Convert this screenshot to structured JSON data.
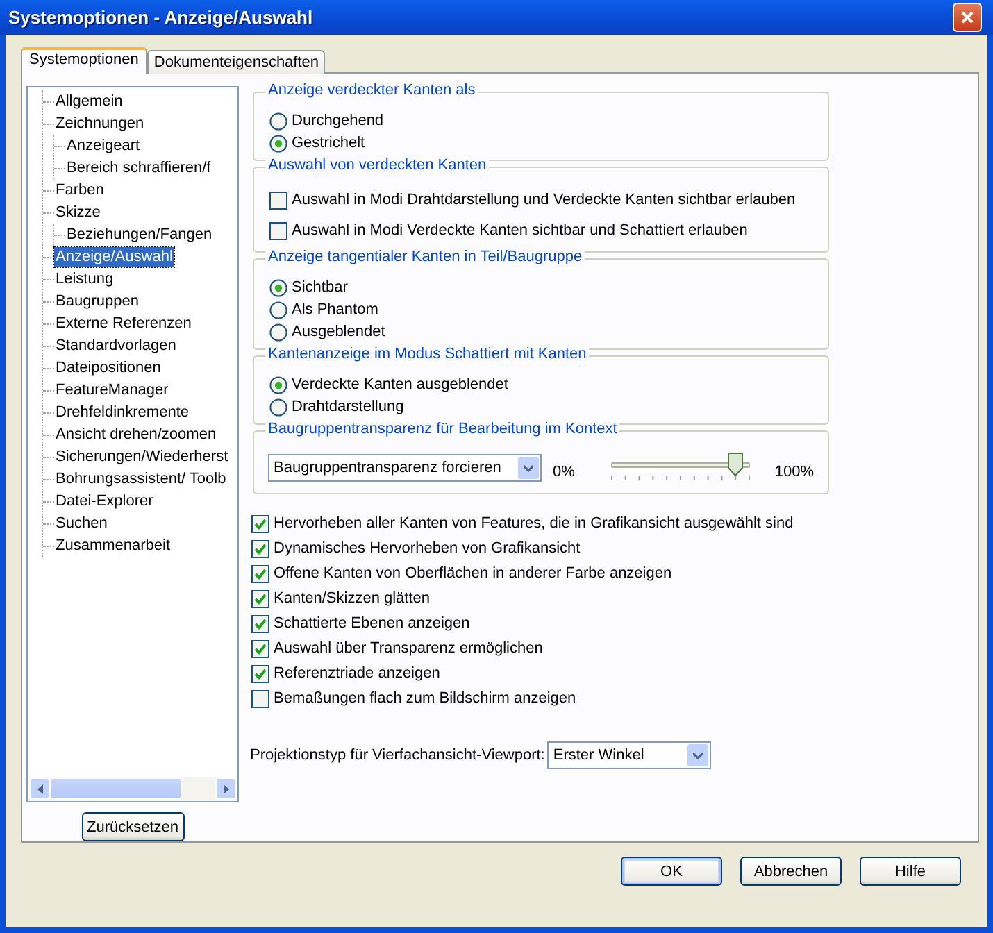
{
  "window": {
    "title": "Systemoptionen - Anzeige/Auswahl"
  },
  "tabs": [
    {
      "label": "Systemoptionen",
      "selected": true
    },
    {
      "label": "Dokumenteigenschaften",
      "selected": false
    }
  ],
  "tree": {
    "items": [
      {
        "label": "Allgemein",
        "selected": false
      },
      {
        "label": "Zeichnungen",
        "selected": false,
        "children": [
          {
            "label": "Anzeigeart",
            "selected": false
          },
          {
            "label": "Bereich schraffieren/f",
            "selected": false
          }
        ]
      },
      {
        "label": "Farben",
        "selected": false
      },
      {
        "label": "Skizze",
        "selected": false,
        "children": [
          {
            "label": "Beziehungen/Fangen",
            "selected": false
          }
        ]
      },
      {
        "label": "Anzeige/Auswahl",
        "selected": true
      },
      {
        "label": "Leistung",
        "selected": false
      },
      {
        "label": "Baugruppen",
        "selected": false
      },
      {
        "label": "Externe Referenzen",
        "selected": false
      },
      {
        "label": "Standardvorlagen",
        "selected": false
      },
      {
        "label": "Dateipositionen",
        "selected": false
      },
      {
        "label": "FeatureManager",
        "selected": false
      },
      {
        "label": "Drehfeldinkremente",
        "selected": false
      },
      {
        "label": "Ansicht drehen/zoomen",
        "selected": false
      },
      {
        "label": "Sicherungen/Wiederherst",
        "selected": false
      },
      {
        "label": "Bohrungsassistent/ Toolb",
        "selected": false
      },
      {
        "label": "Datei-Explorer",
        "selected": false
      },
      {
        "label": "Suchen",
        "selected": false
      },
      {
        "label": "Zusammenarbeit",
        "selected": false
      }
    ]
  },
  "reset_button": "Zurücksetzen",
  "groups": [
    {
      "title": "Anzeige verdeckter Kanten als",
      "options": [
        {
          "kind": "radio",
          "label": "Durchgehend",
          "selected": false
        },
        {
          "kind": "radio",
          "label": "Gestrichelt",
          "selected": true
        }
      ]
    },
    {
      "title": "Auswahl von verdeckten Kanten",
      "options": [
        {
          "kind": "checkbox",
          "label": "Auswahl in Modi Drahtdarstellung und Verdeckte Kanten sichtbar erlauben",
          "checked": false
        },
        {
          "kind": "checkbox",
          "label": "Auswahl in Modi Verdeckte Kanten sichtbar und Schattiert erlauben",
          "checked": false
        }
      ]
    },
    {
      "title": "Anzeige tangentialer Kanten in Teil/Baugruppe",
      "options": [
        {
          "kind": "radio",
          "label": "Sichtbar",
          "selected": true
        },
        {
          "kind": "radio",
          "label": "Als Phantom",
          "selected": false
        },
        {
          "kind": "radio",
          "label": "Ausgeblendet",
          "selected": false
        }
      ]
    },
    {
      "title": "Kantenanzeige im Modus Schattiert mit Kanten",
      "options": [
        {
          "kind": "radio",
          "label": "Verdeckte Kanten ausgeblendet",
          "selected": true
        },
        {
          "kind": "radio",
          "label": "Drahtdarstellung",
          "selected": false
        }
      ]
    },
    {
      "title": "Baugruppentransparenz für Bearbeitung im Kontext",
      "options": [
        {
          "kind": "transparency",
          "dropdown": "Baugruppentransparenz forcieren",
          "min_label": "0%",
          "max_label": "100%",
          "level": 0.9
        }
      ]
    }
  ],
  "checkboxes": [
    {
      "label": "Hervorheben aller Kanten von Features, die in Grafikansicht ausgewählt sind",
      "checked": true
    },
    {
      "label": "Dynamisches Hervorheben von Grafikansicht",
      "checked": true
    },
    {
      "label": "Offene Kanten von Oberflächen in anderer Farbe anzeigen",
      "checked": true
    },
    {
      "label": "Kanten/Skizzen glätten",
      "checked": true
    },
    {
      "label": "Schattierte Ebenen anzeigen",
      "checked": true
    },
    {
      "label": "Auswahl über Transparenz ermöglichen",
      "checked": true
    },
    {
      "label": "Referenztriade anzeigen",
      "checked": true
    },
    {
      "label": "Bemaßungen flach zum Bildschirm anzeigen",
      "checked": false
    }
  ],
  "projection": {
    "label": "Projektionstyp für Vierfachansicht-Viewport:",
    "value": "Erster Winkel"
  },
  "buttons": [
    {
      "label": "OK",
      "default": true
    },
    {
      "label": "Abbrechen",
      "default": false
    },
    {
      "label": "Hilfe",
      "default": false
    }
  ]
}
